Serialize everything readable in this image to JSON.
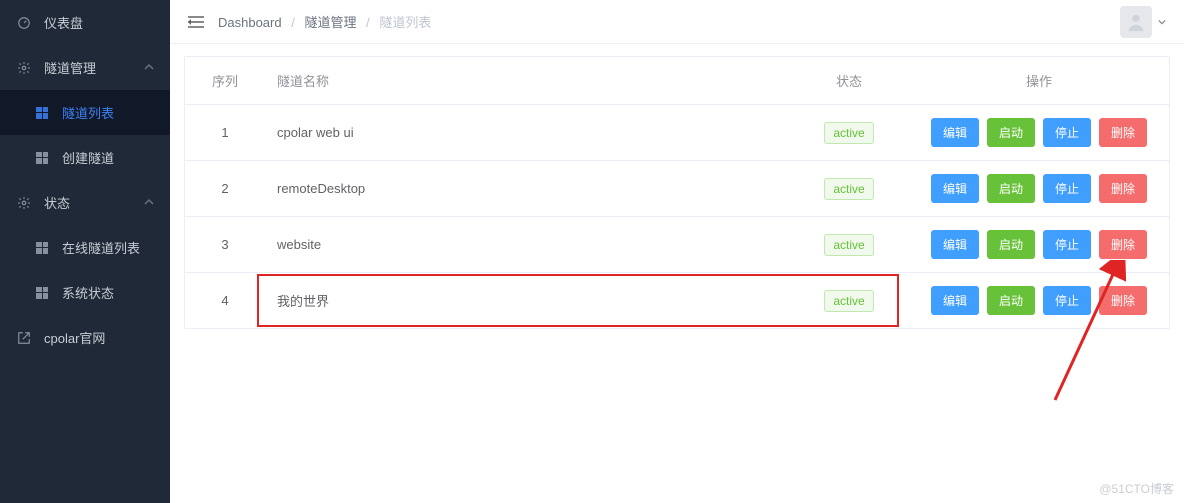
{
  "sidebar": {
    "items": [
      {
        "label": "仪表盘",
        "type": "gauge"
      },
      {
        "label": "隧道管理",
        "type": "gear"
      },
      {
        "label": "隧道列表",
        "type": "grid"
      },
      {
        "label": "创建隧道",
        "type": "grid"
      },
      {
        "label": "状态",
        "type": "gear"
      },
      {
        "label": "在线隧道列表",
        "type": "grid"
      },
      {
        "label": "系统状态",
        "type": "grid"
      },
      {
        "label": "cpolar官网",
        "type": "ext"
      }
    ]
  },
  "breadcrumb": {
    "root": "Dashboard",
    "mid": "隧道管理",
    "leaf": "隧道列表"
  },
  "table": {
    "headers": {
      "seq": "序列",
      "name": "隧道名称",
      "status": "状态",
      "actions": "操作"
    },
    "action_labels": {
      "edit": "编辑",
      "start": "启动",
      "stop": "停止",
      "delete": "删除"
    },
    "rows": [
      {
        "seq": "1",
        "name": "cpolar web ui",
        "status": "active"
      },
      {
        "seq": "2",
        "name": "remoteDesktop",
        "status": "active"
      },
      {
        "seq": "3",
        "name": "website",
        "status": "active"
      },
      {
        "seq": "4",
        "name": "我的世界",
        "status": "active",
        "highlight": true
      }
    ]
  },
  "watermark": "@51CTO博客"
}
